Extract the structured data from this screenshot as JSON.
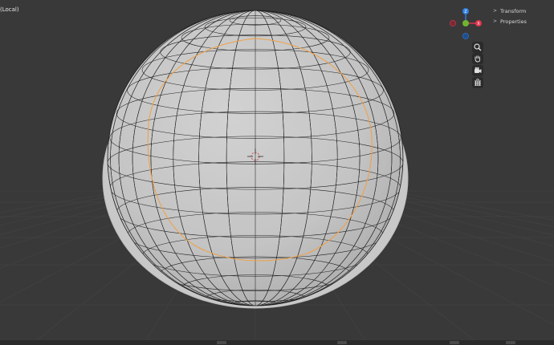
{
  "viewport": {
    "label": "(Local)",
    "background": "#393939",
    "object": "sphere",
    "selection_color": "#f0a044"
  },
  "gizmo": {
    "axes": [
      {
        "name": "Z",
        "color": "#2f7fe0"
      },
      {
        "name": "Y",
        "color": "#6fb52e"
      },
      {
        "name": "X",
        "color": "#e0364e"
      }
    ],
    "negative_axes": [
      {
        "name": "-X",
        "color": "#a02c3c"
      },
      {
        "name": "-Z",
        "color": "#1f5ea8"
      }
    ]
  },
  "navigation": [
    {
      "name": "zoom-icon",
      "glyph": "⌕"
    },
    {
      "name": "hand-icon",
      "glyph": "✋"
    },
    {
      "name": "camera-icon",
      "glyph": "◉"
    },
    {
      "name": "grid-icon",
      "glyph": "▦"
    }
  ],
  "n_panel": {
    "items": [
      {
        "label": "Transform",
        "expanded": false
      },
      {
        "label": "Properties",
        "expanded": false
      }
    ]
  }
}
